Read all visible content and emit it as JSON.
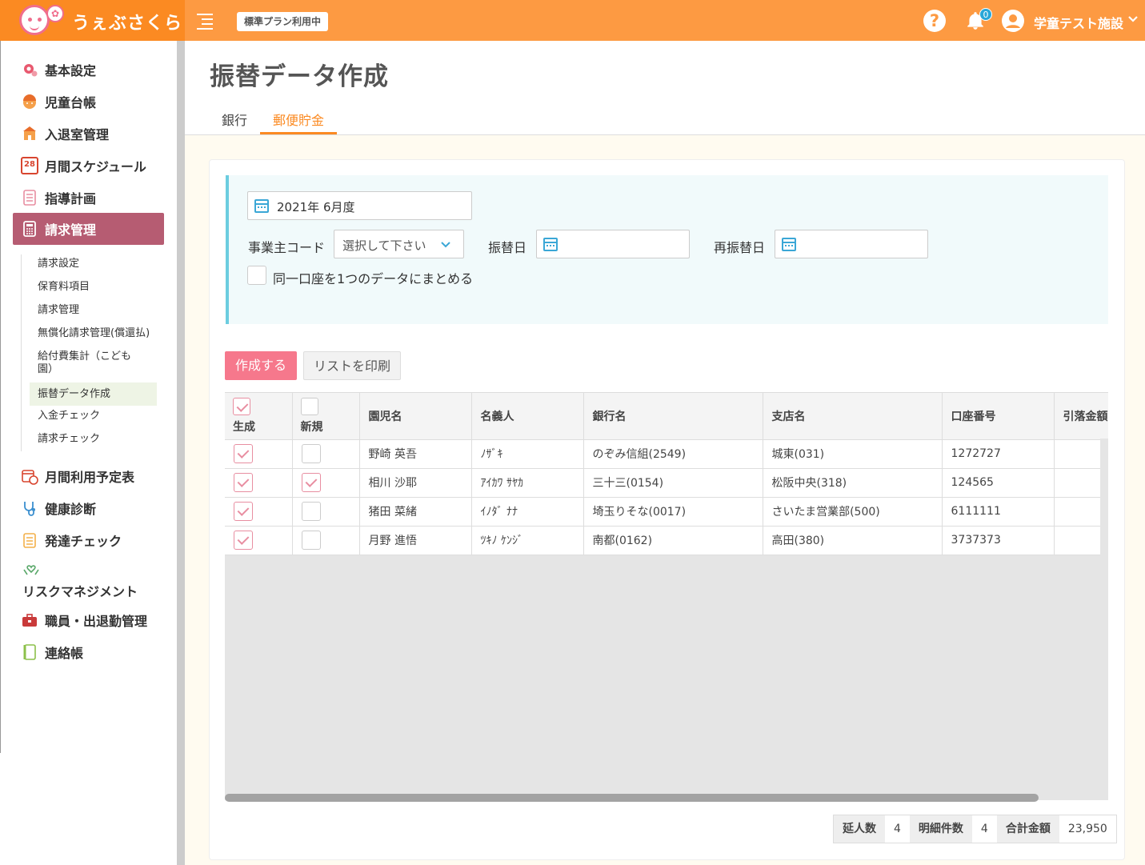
{
  "header": {
    "logo_text": "うぇぶさくら",
    "plan_badge": "標準プラン利用中",
    "notif_count": "0",
    "user_name": "学童テスト施設",
    "colors": {
      "header_bg": "#fd9a42",
      "logo_bg": "#fb8a22"
    }
  },
  "sidebar": {
    "items": [
      {
        "label": "基本設定",
        "icon": "gear-icon"
      },
      {
        "label": "児童台帳",
        "icon": "child-icon"
      },
      {
        "label": "入退室管理",
        "icon": "school-icon"
      },
      {
        "label": "月間スケジュール",
        "icon": "calendar-icon",
        "icon_text": "28"
      },
      {
        "label": "指導計画",
        "icon": "notebook-icon"
      },
      {
        "label": "請求管理",
        "icon": "calculator-icon"
      },
      {
        "label": "月間利用予定表",
        "icon": "calendar-clock-icon"
      },
      {
        "label": "健康診断",
        "icon": "stethoscope-icon"
      },
      {
        "label": "発達チェック",
        "icon": "clipboard-icon"
      },
      {
        "label": "リスクマネジメント",
        "icon": "heart-hands-icon"
      },
      {
        "label": "職員・出退勤管理",
        "icon": "briefcase-icon"
      },
      {
        "label": "連絡帳",
        "icon": "book-icon"
      }
    ],
    "sub_items": [
      "請求設定",
      "保育料項目",
      "請求管理",
      "無償化請求管理(償還払)",
      "給付費集計（こども園）",
      "振替データ作成",
      "入金チェック",
      "請求チェック"
    ]
  },
  "page": {
    "title": "振替データ作成",
    "tabs": [
      "銀行",
      "郵便貯金"
    ],
    "active_tab": "郵便貯金"
  },
  "filters": {
    "month": "2021年 6月度",
    "employer_code_label": "事業主コード",
    "employer_code_value": "選択して下さい",
    "transfer_date_label": "振替日",
    "retransfer_date_label": "再振替日",
    "merge_label": "同一口座を1つのデータにまとめる"
  },
  "actions": {
    "create": "作成する",
    "print": "リストを印刷"
  },
  "table": {
    "headers": [
      "生成",
      "新規",
      "園児名",
      "名義人",
      "銀行名",
      "支店名",
      "口座番号",
      "引落金額"
    ],
    "rows": [
      {
        "generate": true,
        "new": false,
        "child": "野崎 英吾",
        "holder": "ﾉｻﾞｷ",
        "bank": "のぞみ信組(2549)",
        "branch": "城東(031)",
        "account": "1272727",
        "amount": ""
      },
      {
        "generate": true,
        "new": true,
        "child": "相川 沙耶",
        "holder": "ｱｲｶﾜ ｻﾔｶ",
        "bank": "三十三(0154)",
        "branch": "松阪中央(318)",
        "account": "124565",
        "amount": ""
      },
      {
        "generate": true,
        "new": false,
        "child": "猪田 菜緒",
        "holder": "ｲﾉﾀﾞ ﾅﾅ",
        "bank": "埼玉りそな(0017)",
        "branch": "さいたま営業部(500)",
        "account": "6111111",
        "amount": ""
      },
      {
        "generate": true,
        "new": false,
        "child": "月野 進悟",
        "holder": "ﾂｷﾉ ｹﾝｼﾞ",
        "bank": "南都(0162)",
        "branch": "高田(380)",
        "account": "3737373",
        "amount": ""
      }
    ]
  },
  "summary": {
    "persons_label": "延人数",
    "persons": "4",
    "details_label": "明細件数",
    "details": "4",
    "total_label": "合計金額",
    "total": "23,950"
  }
}
